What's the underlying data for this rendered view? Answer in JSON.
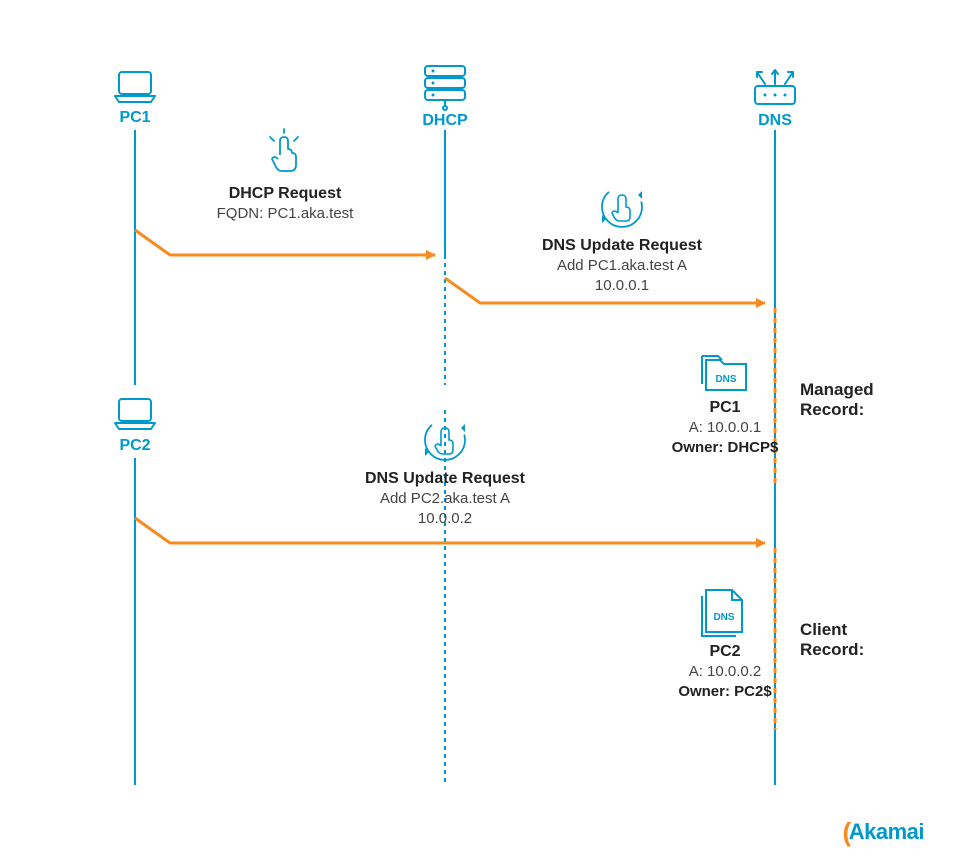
{
  "lanes": {
    "pc1": "PC1",
    "pc2": "PC2",
    "dhcp": "DHCP",
    "dns": "DNS"
  },
  "dhcp_request": {
    "title": "DHCP Request",
    "line1": "FQDN: PC1.aka.test"
  },
  "dns_update_1": {
    "title": "DNS Update Request",
    "line1": "Add PC1.aka.test A",
    "line2": "10.0.0.1"
  },
  "dns_update_2": {
    "title": "DNS Update Request",
    "line1": "Add PC2.aka.test A",
    "line2": "10.0.0.2"
  },
  "record1": {
    "icon_label": "DNS",
    "title": "PC1",
    "a": "A: 10.0.0.1",
    "owner": "Owner: DHCP$",
    "side_label_l1": "Managed",
    "side_label_l2": "Record:"
  },
  "record2": {
    "icon_label": "DNS",
    "title": "PC2",
    "a": "A: 10.0.0.2",
    "owner": "Owner: PC2$",
    "side_label_l1": "Client",
    "side_label_l2": "Record:"
  },
  "brand": "Akamai"
}
